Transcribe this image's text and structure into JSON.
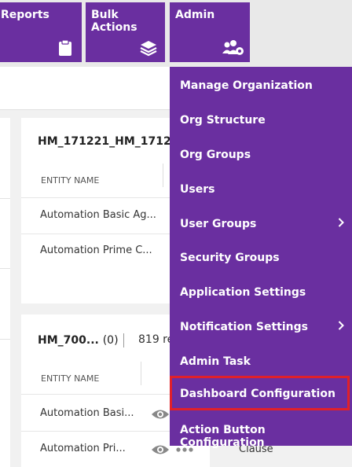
{
  "nav": {
    "reports_label": "Reports",
    "bulk_actions_label": "Bulk Actions",
    "admin_label": "Admin"
  },
  "cards": [
    {
      "title": "HM_171221_HM_1712",
      "column_header": "ENTITY NAME",
      "rows": [
        "Automation Basic Ag...",
        "Automation Prime C..."
      ]
    },
    {
      "title": "HM_700...",
      "count": "(0)",
      "records": "819 re",
      "column_header": "ENTITY NAME",
      "rows": [
        "Automation Basi...",
        "Automation Pri..."
      ]
    }
  ],
  "clause_text": "Clause",
  "admin_menu": {
    "items": [
      {
        "label": "Manage Organization"
      },
      {
        "label": "Org Structure"
      },
      {
        "label": "Org Groups"
      },
      {
        "label": "Users"
      },
      {
        "label": "User Groups"
      },
      {
        "label": "Security Groups"
      },
      {
        "label": "Application Settings"
      },
      {
        "label": "Notification Settings"
      },
      {
        "label": "Admin Task"
      },
      {
        "label": "Dashboard Configuration"
      },
      {
        "label": "Action Button Configuration"
      }
    ]
  },
  "colors": {
    "accent": "#6a2fa0",
    "highlight_border": "#e0202a"
  }
}
